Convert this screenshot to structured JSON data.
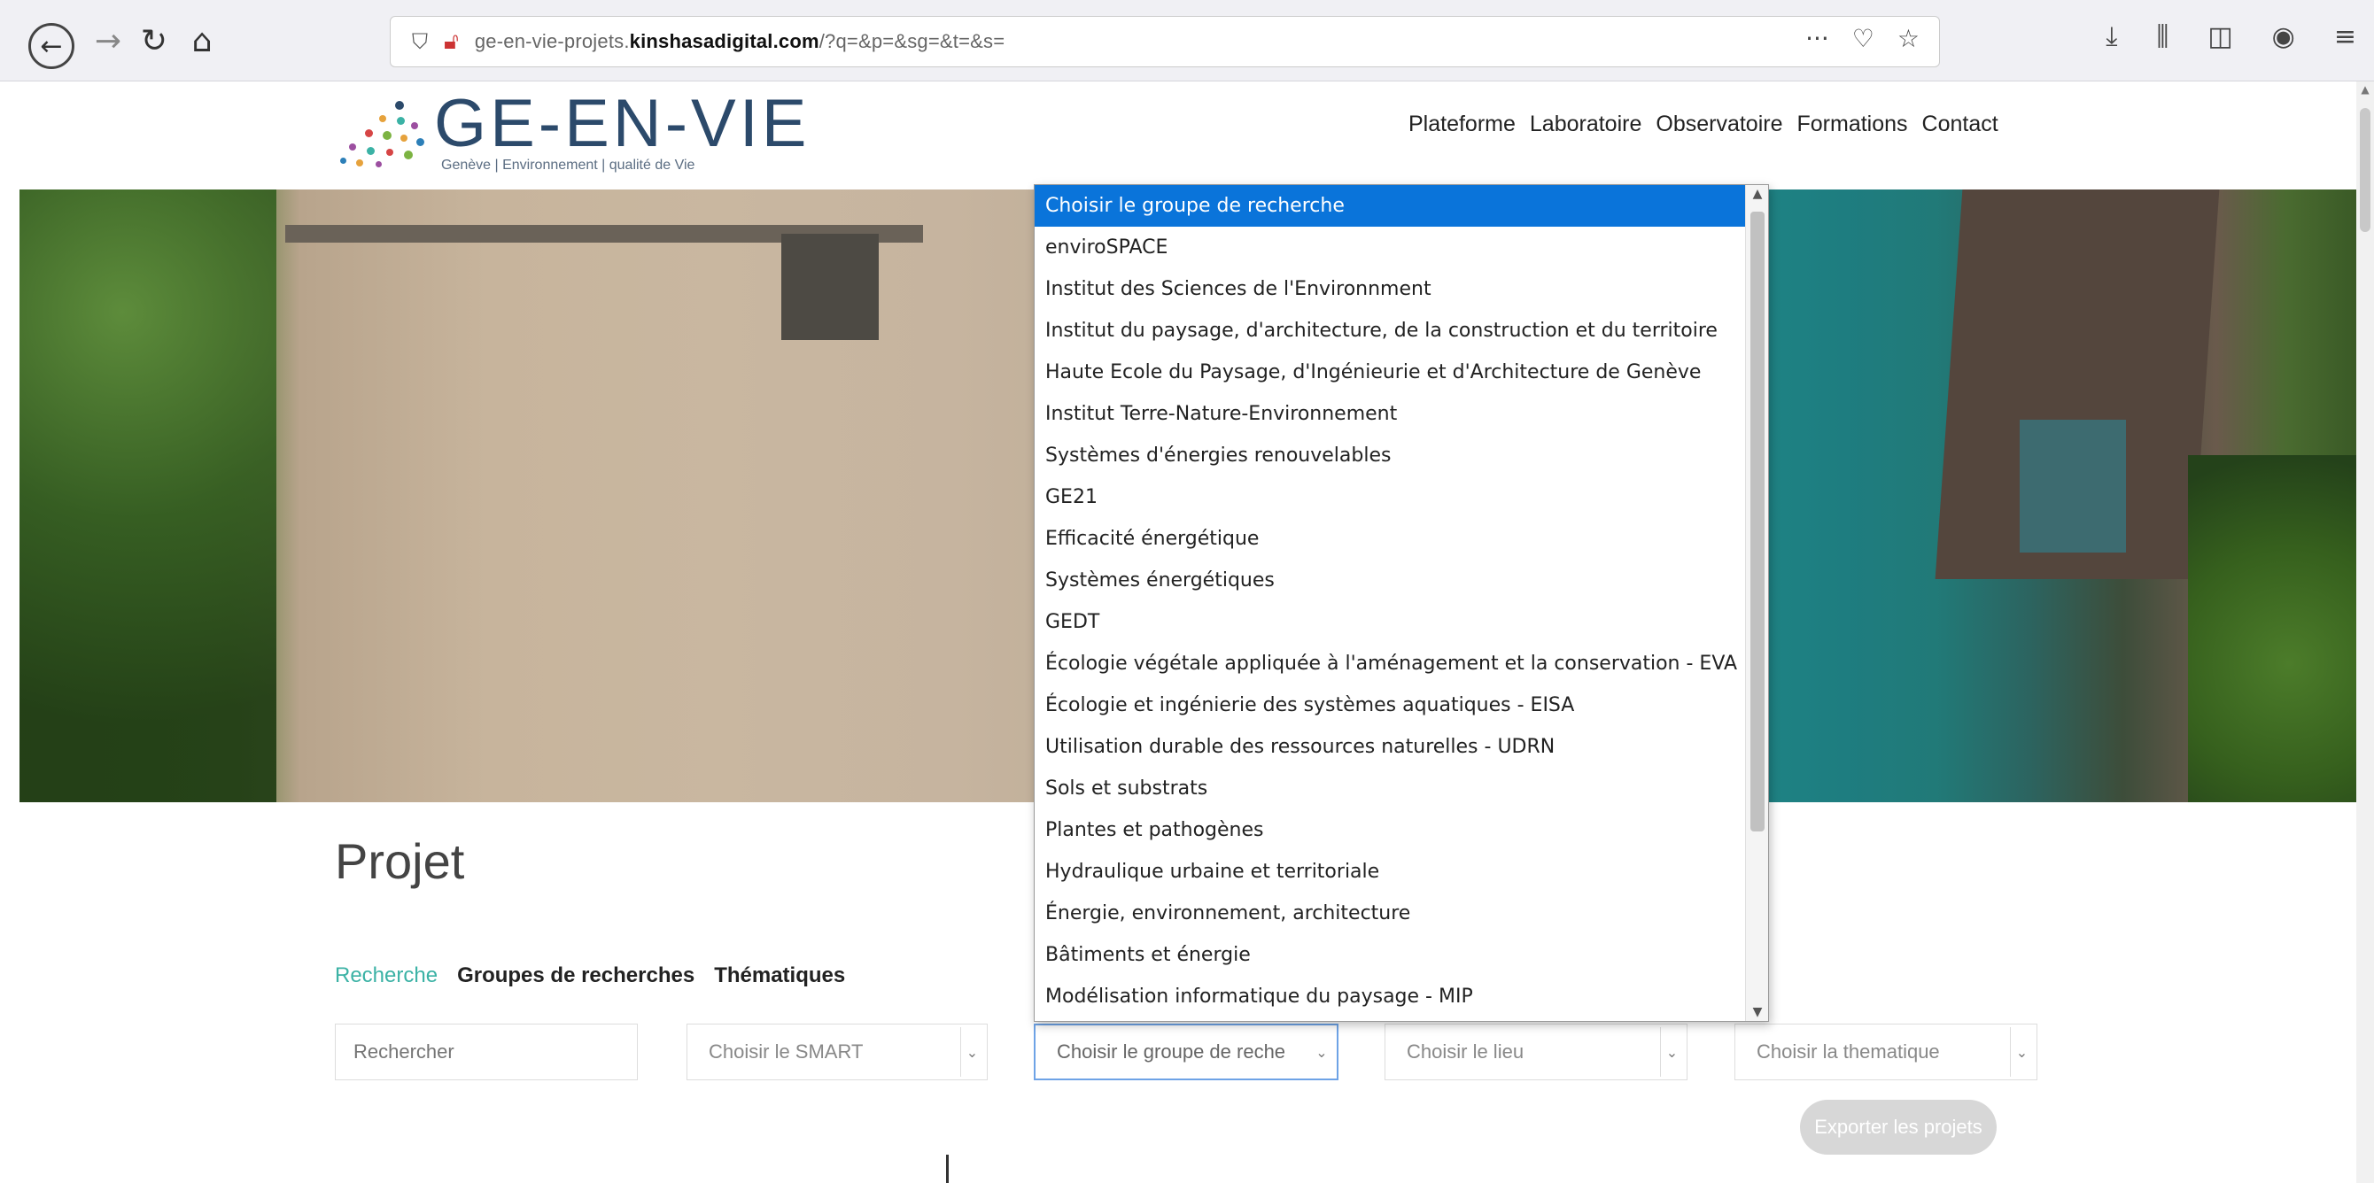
{
  "browser": {
    "url_prefix": "ge-en-vie-projets.",
    "url_domain": "kinshasadigital.com",
    "url_suffix": "/?q=&p=&sg=&t=&s=",
    "icons": [
      "back-icon",
      "forward-icon",
      "reload-icon",
      "home-icon",
      "shield-icon",
      "insecure-lock-icon",
      "more-icon",
      "pocket-icon",
      "star-icon",
      "download-icon",
      "library-icon",
      "sidebar-icon",
      "account-icon",
      "menu-icon"
    ]
  },
  "site": {
    "logo_title": "GE-EN-VIE",
    "logo_subtitle": "Genève | Environnement | qualité de Vie",
    "nav": [
      "Plateforme",
      "Laboratoire",
      "Observatoire",
      "Formations",
      "Contact"
    ]
  },
  "page": {
    "title": "Projet",
    "tabs": [
      {
        "label": "Recherche",
        "active": true
      },
      {
        "label": "Groupes de recherches",
        "active": false
      },
      {
        "label": "Thématiques",
        "active": false
      }
    ],
    "filters": {
      "search_placeholder": "Rechercher",
      "smart": "Choisir le SMART",
      "groupe": "Choisir le groupe de reche",
      "lieu": "Choisir le lieu",
      "thematique": "Choisir la thematique"
    },
    "export_label": "Exporter les projets"
  },
  "dropdown": {
    "options": [
      "Choisir le groupe de recherche",
      "enviroSPACE",
      "Institut des Sciences de l'Environnment",
      "Institut du paysage, d'architecture, de la construction et du territoire",
      "Haute Ecole du Paysage, d'Ingénieurie et d'Architecture de Genève",
      "Institut Terre-Nature-Environnement",
      "Systèmes d'énergies renouvelables",
      "GE21",
      "Efficacité énergétique",
      "Systèmes énergétiques",
      "GEDT",
      "Écologie végétale appliquée à l'aménagement et la conservation - EVA",
      "Écologie et ingénierie des systèmes aquatiques - EISA",
      "Utilisation durable des ressources naturelles - UDRN",
      "Sols et substrats",
      "Plantes et pathogènes",
      "Hydraulique urbaine et territoriale",
      "Énergie, environnement, architecture",
      "Bâtiments et énergie",
      "Modélisation informatique du paysage - MIP"
    ],
    "selected_index": 0
  },
  "colors": {
    "accent": "#3bb2a5",
    "selection": "#0a74da",
    "logo": "#2c4a6b"
  }
}
